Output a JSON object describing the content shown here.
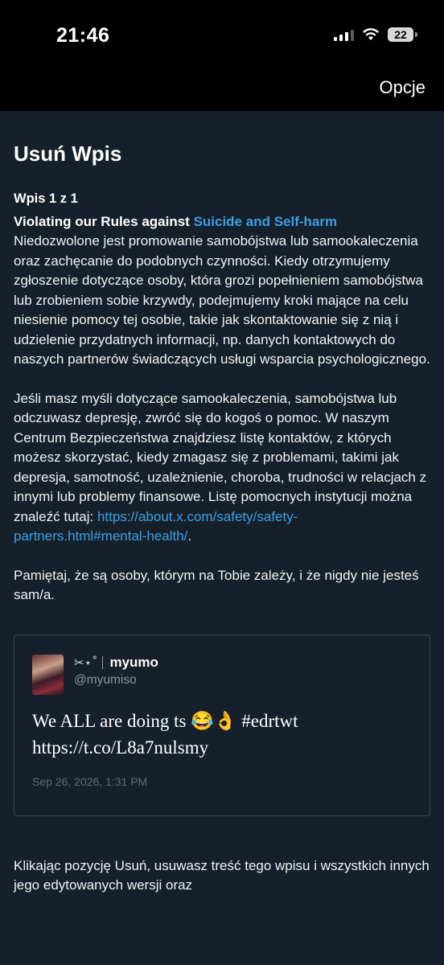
{
  "status_bar": {
    "time": "21:46",
    "battery": "22",
    "icons": [
      "signal-icon",
      "wifi-icon",
      "battery-icon"
    ]
  },
  "header": {
    "options_label": "Opcje"
  },
  "page": {
    "title": "Usuń Wpis",
    "post_count": "Wpis 1 z 1",
    "rule_prefix": "Violating our Rules against ",
    "rule_link": "Suicide and Self-harm",
    "paragraph1": "Niedozwolone jest promowanie samobójstwa lub samookaleczenia oraz zachęcanie do podobnych czynności. Kiedy otrzymujemy zgłoszenie dotyczące osoby, która grozi popełnieniem samobójstwa lub zrobieniem sobie krzywdy, podejmujemy kroki mające na celu niesienie pomocy tej osobie, takie jak skontaktowanie się z nią i udzielenie przydatnych informacji, np. danych kontaktowych do naszych partnerów świadczących usługi wsparcia psychologicznego.",
    "paragraph2": "Jeśli masz myśli dotyczące samookaleczenia, samobójstwa lub odczuwasz depresję, zwróć się do kogoś o pomoc. W naszym Centrum Bezpieczeństwa znajdziesz listę kontaktów, z których możesz skorzystać, kiedy zmagasz się z problemami, takimi jak depresja, samotność, uzależnienie, choroba, trudności w relacjach z innymi lub problemy finansowe. Listę pomocnych instytucji można znaleźć tutaj: ",
    "paragraph2_link": "https://about.x.com/safety/safety-partners.html#mental-health/",
    "paragraph2_end": ".",
    "paragraph3": "Pamiętaj, że są osoby, którym na Tobie zależy, i że nigdy nie jesteś sam/a."
  },
  "tweet": {
    "name_deco": "✂︎⋆˚",
    "display_name": "myumo",
    "handle": "@myumiso",
    "text_line1": "We ALL are doing ts 😂👌 #edrtwt",
    "text_line2": "https://t.co/L8a7nulsmy",
    "date": "Sep 26, 2026, 1:31 PM"
  },
  "footer": {
    "text": "Klikając pozycję Usuń, usuwasz treść tego wpisu i wszystkich innych jego edytowanych wersji oraz"
  },
  "colors": {
    "background": "#15202b",
    "link": "#3e9fe3",
    "border": "#38444d",
    "muted": "#8899a6"
  }
}
